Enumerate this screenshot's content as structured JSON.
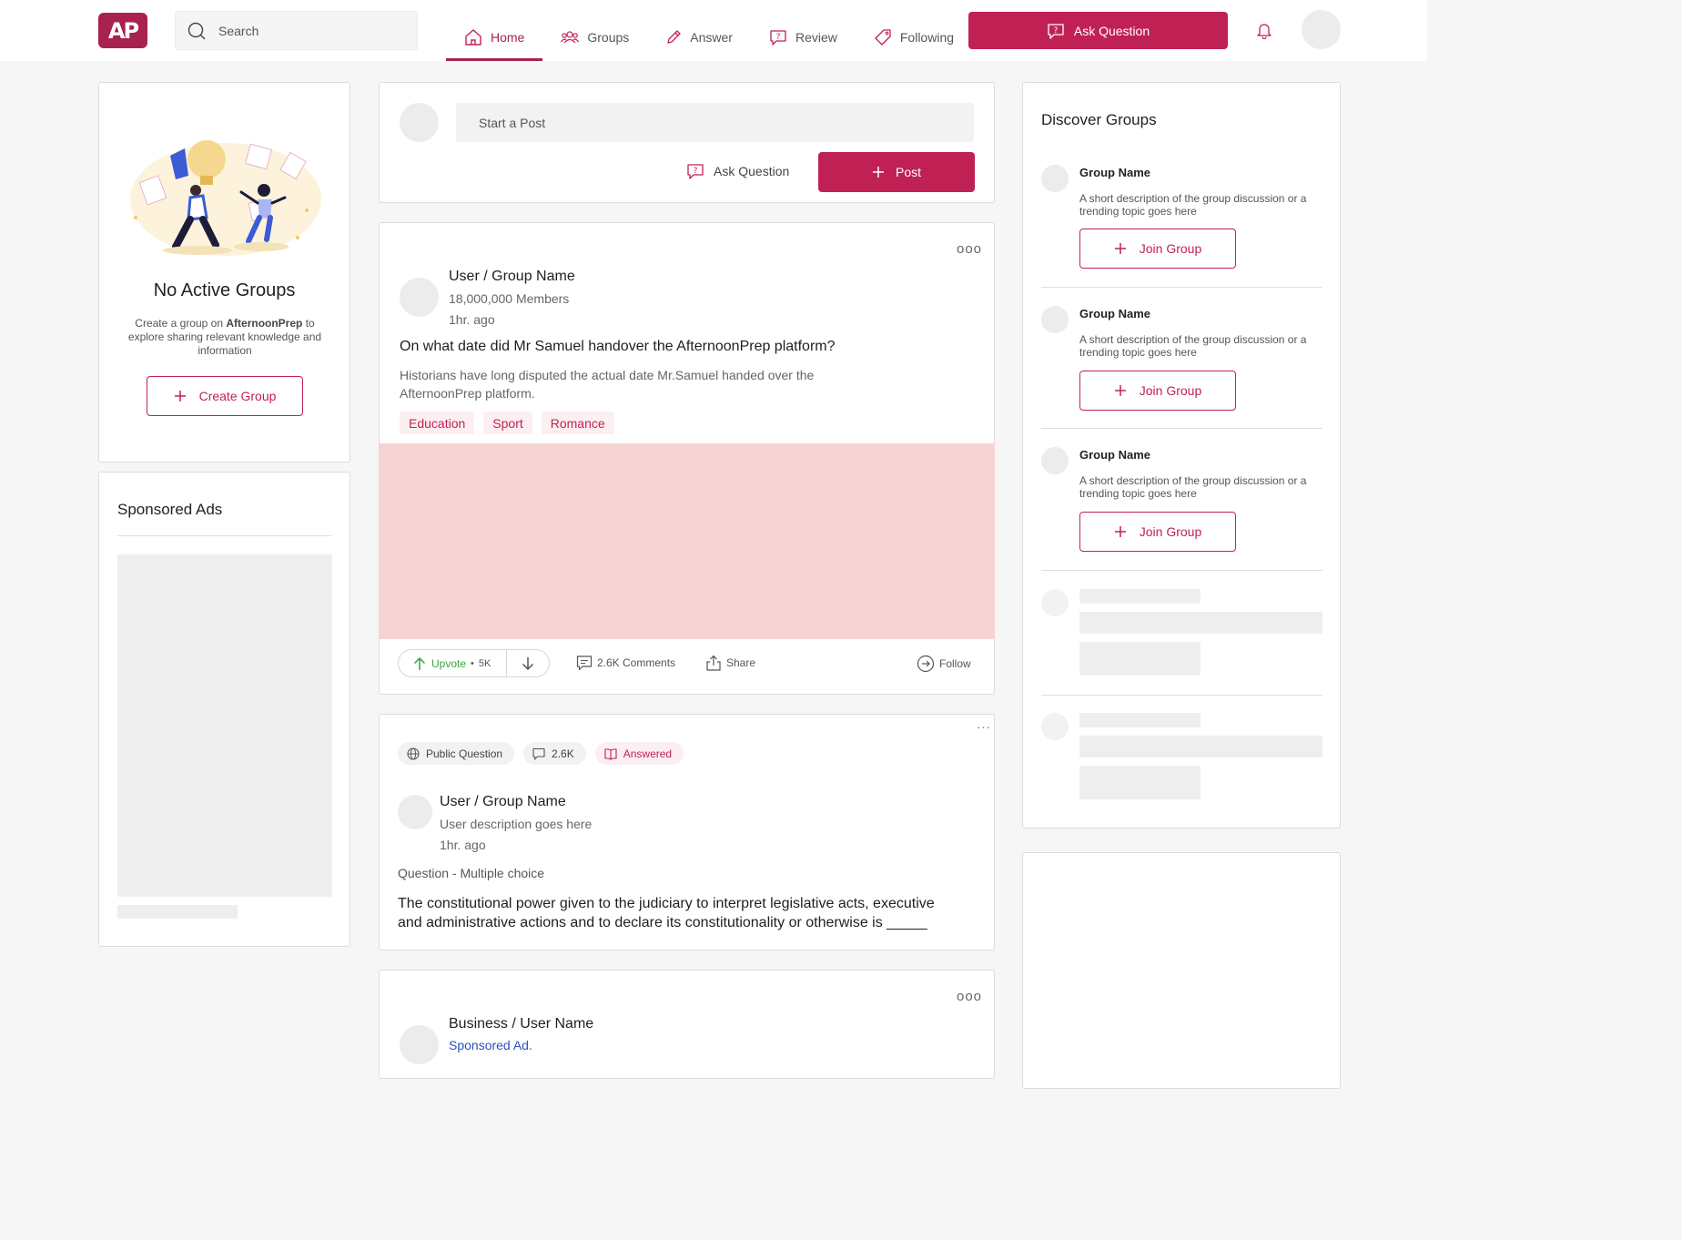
{
  "brand": {
    "logo_text": "AP",
    "accent": "#c02155"
  },
  "search": {
    "placeholder": "Search"
  },
  "nav": {
    "items": [
      {
        "label": "Home",
        "icon": "home-icon",
        "active": true
      },
      {
        "label": "Groups",
        "icon": "groups-icon",
        "active": false
      },
      {
        "label": "Answer",
        "icon": "pencil-icon",
        "active": false
      },
      {
        "label": "Review",
        "icon": "review-icon",
        "active": false
      },
      {
        "label": "Following",
        "icon": "tag-icon",
        "active": false
      }
    ],
    "ask_button": "Ask Question"
  },
  "left": {
    "no_groups_title": "No Active Groups",
    "no_groups_desc_before": "Create a group on ",
    "no_groups_desc_brand": "AfternoonPrep",
    "no_groups_desc_after": " to explore sharing relevant knowledge and information",
    "create_group_button": "Create Group",
    "sponsored_heading": "Sponsored Ads"
  },
  "composer": {
    "placeholder": "Start a Post",
    "ask_label": "Ask Question",
    "post_button": "Post"
  },
  "post1": {
    "author": "User / Group Name",
    "members": "18,000,000 Members",
    "time": "1hr. ago",
    "title": "On what date did Mr Samuel handover the AfternoonPrep platform?",
    "body": "Historians have long disputed the actual date Mr.Samuel handed over the AfternoonPrep platform.",
    "tags": [
      "Education",
      "Sport",
      "Romance"
    ],
    "upvote_label": "Upvote",
    "upvote_count": "5K",
    "comments": "2.6K Comments",
    "share": "Share",
    "follow": "Follow"
  },
  "post2": {
    "pills": {
      "visibility": "Public Question",
      "count": "2.6K",
      "status": "Answered"
    },
    "author": "User / Group Name",
    "description": "User description goes here",
    "time": "1hr. ago",
    "question_type": "Question - Multiple choice",
    "question": "The constitutional power given to the judiciary to interpret legislative acts, executive and administrative actions and to declare its constitutionality or otherwise is _____"
  },
  "post3": {
    "author": "Business / User Name",
    "sponsored": "Sponsored Ad."
  },
  "right": {
    "heading": "Discover Groups",
    "groups": [
      {
        "name": "Group Name",
        "description": "A short description of the group discussion or a trending topic goes here",
        "button": "Join Group"
      },
      {
        "name": "Group Name",
        "description": "A short description of the group discussion or a trending topic goes here",
        "button": "Join Group"
      },
      {
        "name": "Group Name",
        "description": "A short description of the group discussion or a trending topic goes here",
        "button": "Join Group"
      }
    ]
  }
}
